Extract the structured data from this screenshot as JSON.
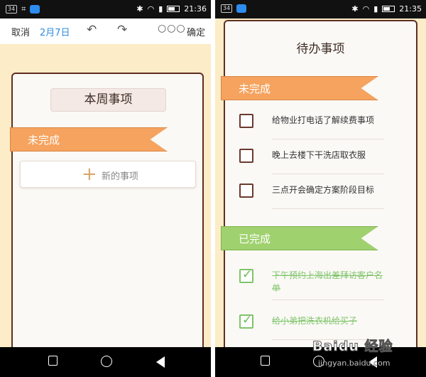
{
  "left": {
    "status": {
      "badge": "34",
      "time": "21:36"
    },
    "toolbar": {
      "cancel": "取消",
      "date": "2月7日",
      "ok": "确定"
    },
    "week_title": "本周事项",
    "incomplete_label": "未完成",
    "new_item": "新的事项"
  },
  "right": {
    "status": {
      "badge": "34",
      "time": "21:35"
    },
    "title": "待办事项",
    "incomplete_label": "未完成",
    "incomplete": [
      {
        "text": "给物业打电话了解续费事项",
        "checked": false
      },
      {
        "text": "晚上去楼下干洗店取衣服",
        "checked": false
      },
      {
        "text": "三点开会确定方案阶段目标",
        "checked": false
      }
    ],
    "completed_label": "已完成",
    "completed": [
      {
        "text": "下午预约上海出差拜访客户名单",
        "checked": true
      },
      {
        "text": "给小弟把洗衣机给买子",
        "checked": true
      }
    ]
  },
  "watermark": {
    "logo": "Baidu 经验",
    "url": "jingyan.baidu.com"
  },
  "colors": {
    "canvas": "#fcecc7",
    "card_border": "#5e2f22",
    "incomplete_ribbon": "#f5a35e",
    "completed_ribbon": "#9fd16e",
    "date_link": "#2f8ce0"
  }
}
